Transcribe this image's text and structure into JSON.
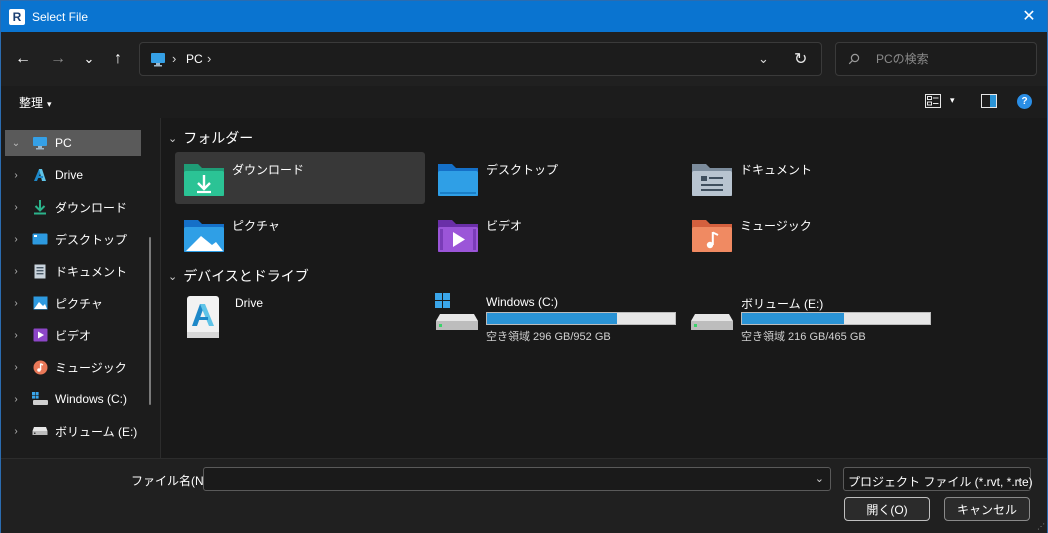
{
  "window": {
    "title": "Select File",
    "app_icon_letter": "R",
    "close_glyph": "✕"
  },
  "nav": {
    "back_glyph": "←",
    "forward_glyph": "→",
    "recent_glyph": "⌄",
    "up_glyph": "↑",
    "breadcrumb": [
      "PC"
    ],
    "crumb_sep": "›",
    "address_dropdown_glyph": "⌄",
    "refresh_glyph": "↻",
    "search_placeholder": "PCの検索"
  },
  "commandbar": {
    "organize_label": "整理",
    "caret_glyph": "▾",
    "help_glyph": "?"
  },
  "sidebar": {
    "items": [
      {
        "label": "PC",
        "icon": "pc-icon",
        "chev": "⌄",
        "selected": true
      },
      {
        "label": "Drive",
        "icon": "autodesk-drive-icon",
        "chev": "›"
      },
      {
        "label": "ダウンロード",
        "icon": "download-icon",
        "chev": "›"
      },
      {
        "label": "デスクトップ",
        "icon": "desktop-icon",
        "chev": "›"
      },
      {
        "label": "ドキュメント",
        "icon": "document-icon",
        "chev": "›"
      },
      {
        "label": "ピクチャ",
        "icon": "pictures-icon",
        "chev": "›"
      },
      {
        "label": "ビデオ",
        "icon": "video-icon",
        "chev": "›"
      },
      {
        "label": "ミュージック",
        "icon": "music-icon",
        "chev": "›"
      },
      {
        "label": "Windows (C:)",
        "icon": "windows-drive-icon",
        "chev": "›"
      },
      {
        "label": "ボリューム (E:)",
        "icon": "drive-icon",
        "chev": "›"
      }
    ]
  },
  "content": {
    "folders_header": "フォルダー",
    "devices_header": "デバイスとドライブ",
    "group_chev": "⌄",
    "folders": [
      {
        "label": "ダウンロード",
        "icon": "downloads-folder-icon",
        "selected": true
      },
      {
        "label": "デスクトップ",
        "icon": "desktop-folder-icon"
      },
      {
        "label": "ドキュメント",
        "icon": "documents-folder-icon"
      },
      {
        "label": "ピクチャ",
        "icon": "pictures-folder-icon"
      },
      {
        "label": "ビデオ",
        "icon": "videos-folder-icon"
      },
      {
        "label": "ミュージック",
        "icon": "music-folder-icon"
      }
    ],
    "drives": [
      {
        "label": "Drive",
        "icon": "autodesk-drive-icon"
      },
      {
        "label": "Windows (C:)",
        "icon": "windows-drive-icon",
        "usage": 0.69,
        "free_text": "空き領域 296 GB/952 GB"
      },
      {
        "label": "ボリューム (E:)",
        "icon": "drive-icon",
        "usage": 0.54,
        "free_text": "空き領域 216 GB/465 GB"
      }
    ]
  },
  "footer": {
    "filename_label": "ファイル名(N):",
    "filename_value": "",
    "dropdown_glyph": "⌄",
    "filetype_value": "プロジェクト ファイル (*.rvt, *.rte)",
    "open_label": "開く(O)",
    "cancel_label": "キャンセル",
    "grip_glyph": "⋰"
  },
  "colors": {
    "titlebar": "#0a74d0",
    "accent": "#2a93d5",
    "selection": "#383838"
  }
}
